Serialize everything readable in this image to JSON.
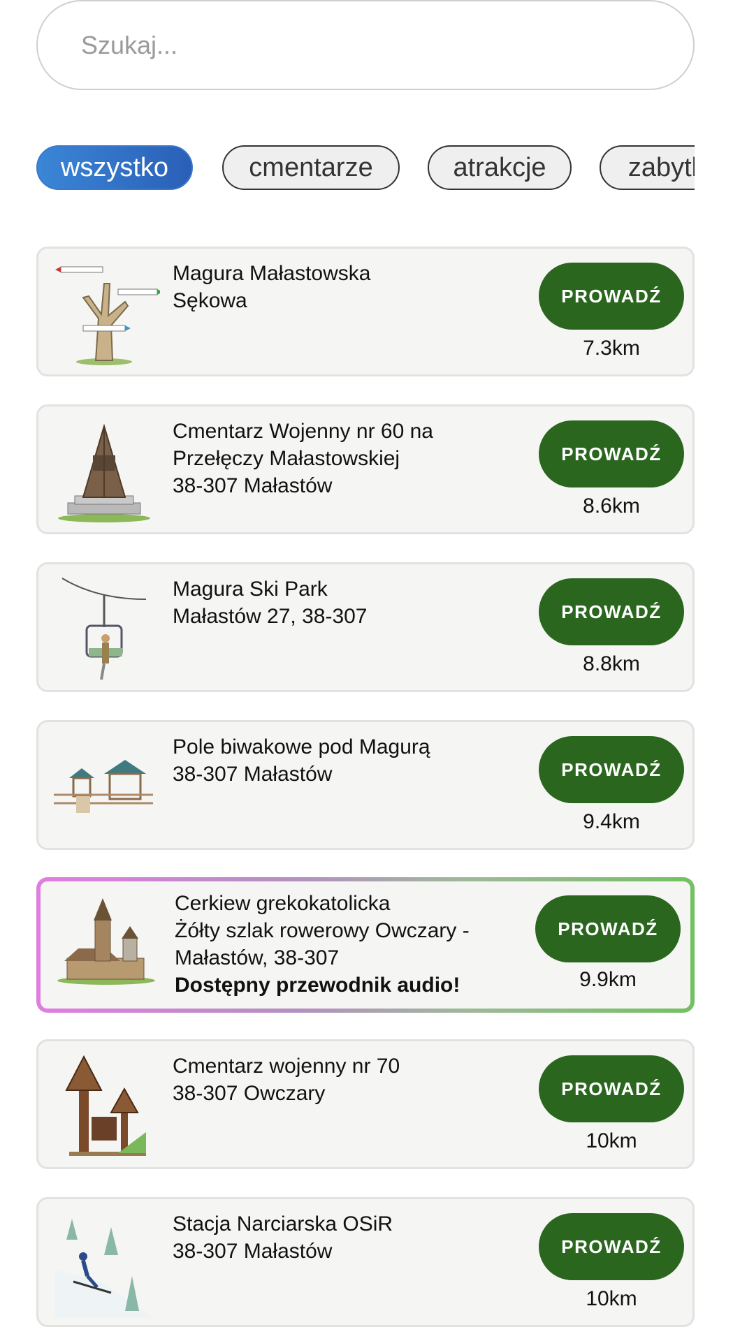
{
  "search": {
    "placeholder": "Szukaj..."
  },
  "filters": [
    {
      "label": "wszystko",
      "active": true
    },
    {
      "label": "cmentarze",
      "active": false
    },
    {
      "label": "atrakcje",
      "active": false
    },
    {
      "label": "zabytki",
      "active": false
    }
  ],
  "places": [
    {
      "icon": "signpost-tree-icon",
      "lines": [
        "Magura Małastowska",
        "Sękowa"
      ],
      "audio": "",
      "button": "PROWADŹ",
      "distance": "7.3km"
    },
    {
      "icon": "bell-tower-icon",
      "lines": [
        "Cmentarz Wojenny nr 60 na",
        "Przełęczy Małastowskiej",
        "38-307 Małastów"
      ],
      "audio": "",
      "button": "PROWADŹ",
      "distance": "8.6km"
    },
    {
      "icon": "chairlift-icon",
      "lines": [
        "Magura Ski Park",
        "Małastów 27, 38-307"
      ],
      "audio": "",
      "button": "PROWADŹ",
      "distance": "8.8km"
    },
    {
      "icon": "bivouac-shelters-icon",
      "lines": [
        "Pole biwakowe pod Magurą",
        "38-307 Małastów"
      ],
      "audio": "",
      "button": "PROWADŹ",
      "distance": "9.4km"
    },
    {
      "icon": "wooden-church-icon",
      "lines": [
        "Cerkiew grekokatolicka",
        "Żółty szlak rowerowy Owczary -",
        "Małastów, 38-307"
      ],
      "audio": "Dostępny przewodnik audio!",
      "button": "PROWADŹ",
      "distance": "9.9km",
      "featured": true
    },
    {
      "icon": "wayside-shrine-icon",
      "lines": [
        "Cmentarz wojenny nr 70",
        "38-307 Owczary"
      ],
      "audio": "",
      "button": "PROWADŹ",
      "distance": "10km"
    },
    {
      "icon": "skier-icon",
      "lines": [
        "Stacja Narciarska OSiR",
        "38-307 Małastów"
      ],
      "audio": "",
      "button": "PROWADŹ",
      "distance": "10km"
    }
  ],
  "colors": {
    "accent_green": "#2a661e",
    "chip_active": "#3b86d6",
    "card_bg": "#f5f6f4"
  }
}
